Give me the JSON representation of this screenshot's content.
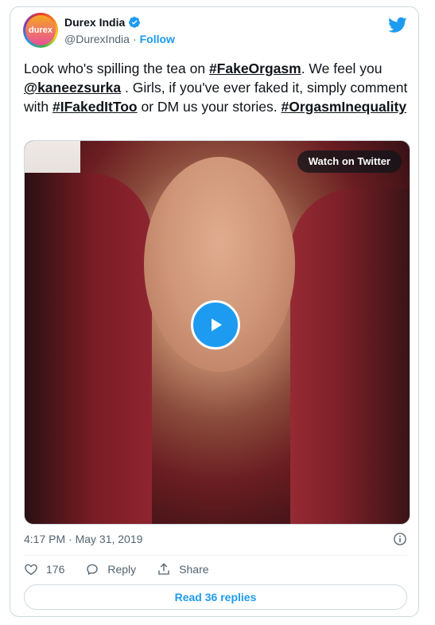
{
  "author": {
    "display_name": "Durex India",
    "handle": "@DurexIndia",
    "separator": "·",
    "follow_label": "Follow",
    "avatar_text": "durex"
  },
  "tweet": {
    "t1": "Look who's spilling the tea on ",
    "tag1": "#FakeOrgasm",
    "t2": ". We feel you ",
    "mention": "@kaneezsurka",
    "t3": " . Girls, if you've ever faked it, simply comment with ",
    "tag2": "#IFakedItToo",
    "t4": " or DM us your stories. ",
    "tag3": "#OrgasmInequality"
  },
  "media": {
    "watch_label": "Watch on Twitter"
  },
  "timestamp": "4:17 PM · May 31, 2019",
  "actions": {
    "like_count": "176",
    "reply_label": "Reply",
    "share_label": "Share"
  },
  "read_replies_label": "Read 36 replies",
  "colors": {
    "accent": "#1d9bf0",
    "text": "#0f1419",
    "muted": "#536471",
    "border": "#cfd9de"
  },
  "icons": [
    "verified-badge-icon",
    "twitter-bird-icon",
    "play-icon",
    "info-icon",
    "heart-icon",
    "reply-icon",
    "share-icon"
  ]
}
